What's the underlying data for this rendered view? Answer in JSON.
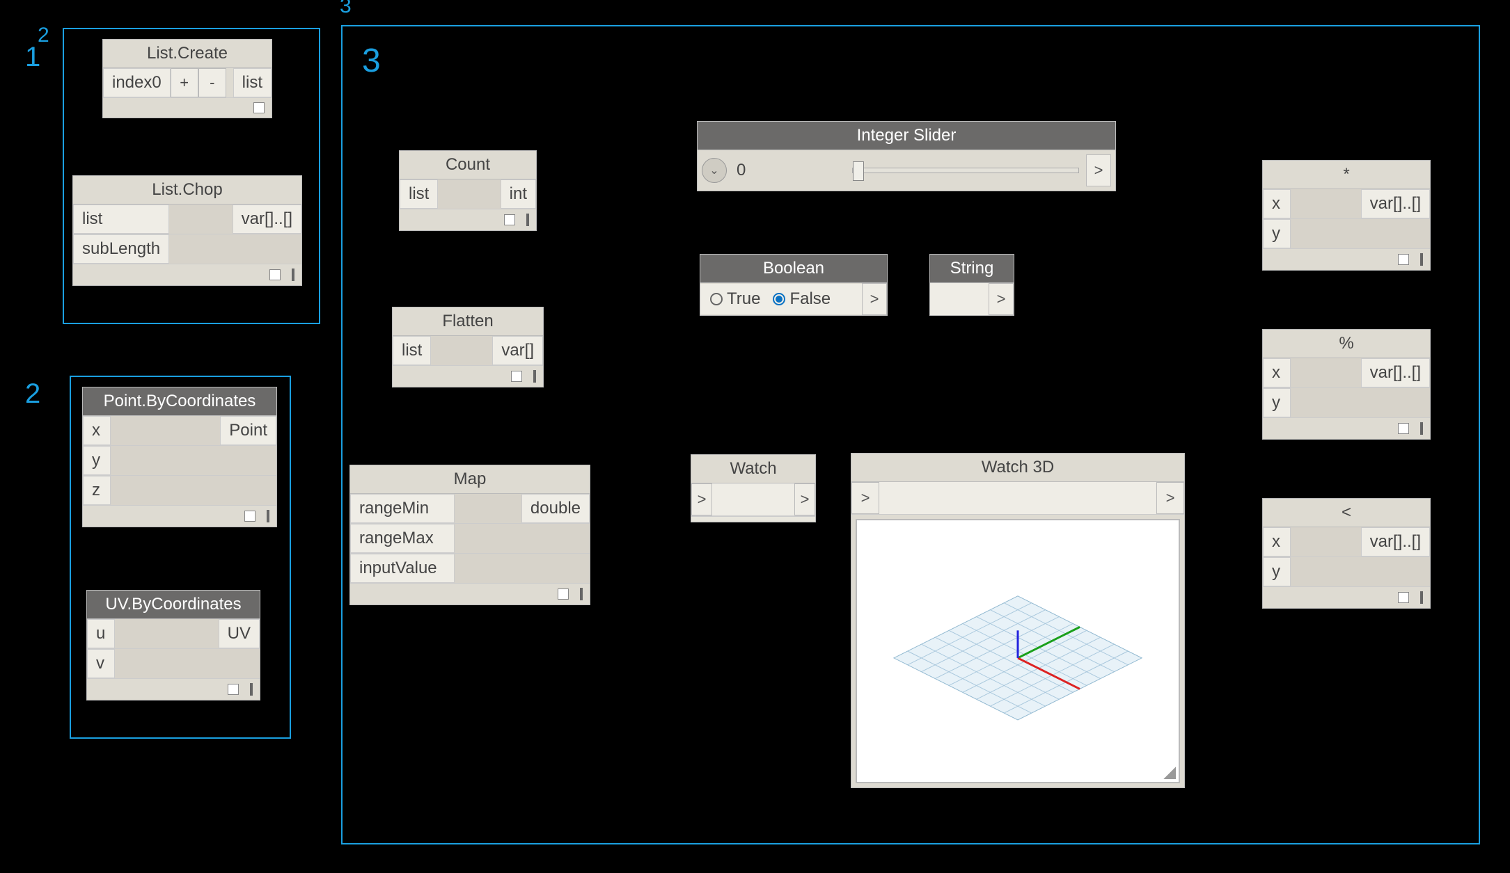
{
  "regions": {
    "r1_label": "1",
    "r2_label": "2",
    "r3_label": "3",
    "r3_top_label": "3"
  },
  "nodes": {
    "list_create": {
      "title": "List.Create",
      "in_port": "index0",
      "plus": "+",
      "minus": "-",
      "out_port": "list"
    },
    "list_chop": {
      "title": "List.Chop",
      "in1": "list",
      "in2": "subLength",
      "out": "var[]..[]"
    },
    "point_bycoord": {
      "title": "Point.ByCoordinates",
      "in1": "x",
      "in2": "y",
      "in3": "z",
      "out": "Point"
    },
    "uv_bycoord": {
      "title": "UV.ByCoordinates",
      "in1": "u",
      "in2": "v",
      "out": "UV"
    },
    "count": {
      "title": "Count",
      "in": "list",
      "out": "int"
    },
    "flatten": {
      "title": "Flatten",
      "in": "list",
      "out": "var[]"
    },
    "map": {
      "title": "Map",
      "in1": "rangeMin",
      "in2": "rangeMax",
      "in3": "inputValue",
      "out": "double"
    },
    "int_slider": {
      "title": "Integer Slider",
      "value": "0",
      "chev": ">"
    },
    "boolean": {
      "title": "Boolean",
      "true_label": "True",
      "false_label": "False",
      "chev": ">"
    },
    "string": {
      "title": "String",
      "chev": ">"
    },
    "watch": {
      "title": "Watch",
      "chev_l": ">",
      "chev_r": ">"
    },
    "watch3d": {
      "title": "Watch 3D",
      "chev_l": ">",
      "chev_r": ">"
    },
    "multiply": {
      "title": "*",
      "in1": "x",
      "in2": "y",
      "out": "var[]..[]"
    },
    "modulo": {
      "title": "%",
      "in1": "x",
      "in2": "y",
      "out": "var[]..[]"
    },
    "lt": {
      "title": "<",
      "in1": "x",
      "in2": "y",
      "out": "var[]..[]"
    }
  }
}
